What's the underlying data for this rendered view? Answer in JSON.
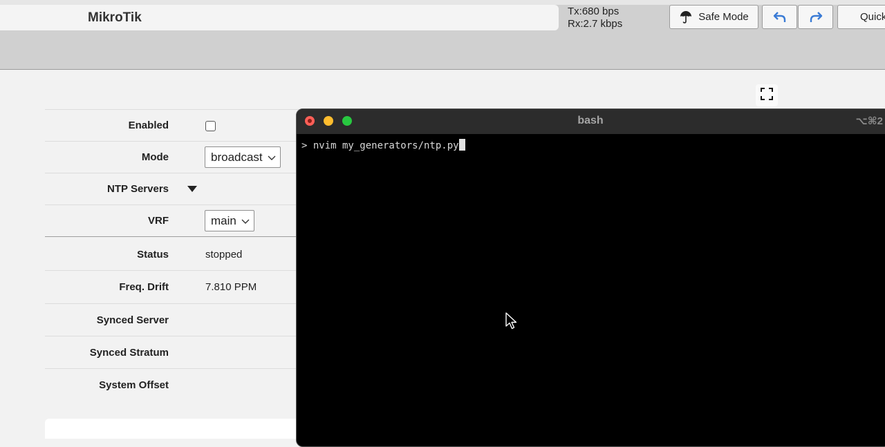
{
  "header": {
    "app_title": "MikroTik",
    "tx": "Tx:680 bps",
    "rx": "Rx:2.7 kbps",
    "safe_mode_label": "Safe Mode",
    "quick_label": "Quick"
  },
  "form": {
    "enabled": {
      "label": "Enabled",
      "checked": false
    },
    "mode": {
      "label": "Mode",
      "value": "broadcast"
    },
    "ntp_servers": {
      "label": "NTP Servers"
    },
    "vrf": {
      "label": "VRF",
      "value": "main"
    },
    "status": {
      "label": "Status",
      "value": "stopped"
    },
    "freq_drift": {
      "label": "Freq. Drift",
      "value": "7.810 PPM"
    },
    "synced_server": {
      "label": "Synced Server",
      "value": ""
    },
    "synced_stratum": {
      "label": "Synced Stratum",
      "value": ""
    },
    "system_offset": {
      "label": "System Offset",
      "value": ""
    }
  },
  "terminal": {
    "title": "bash",
    "shortcut": "⌥⌘2",
    "prompt": "> ",
    "command": "nvim my_generators/ntp.py"
  },
  "colors": {
    "close": "#ff5f57",
    "minimize": "#febc2e",
    "maximize": "#28c840",
    "accent_blue": "#3a7bd5"
  },
  "icons": [
    "umbrella-icon",
    "undo-icon",
    "redo-icon",
    "fullscreen-icon",
    "dropdown-caret-icon",
    "chevron-down-icon",
    "mouse-pointer-icon"
  ]
}
